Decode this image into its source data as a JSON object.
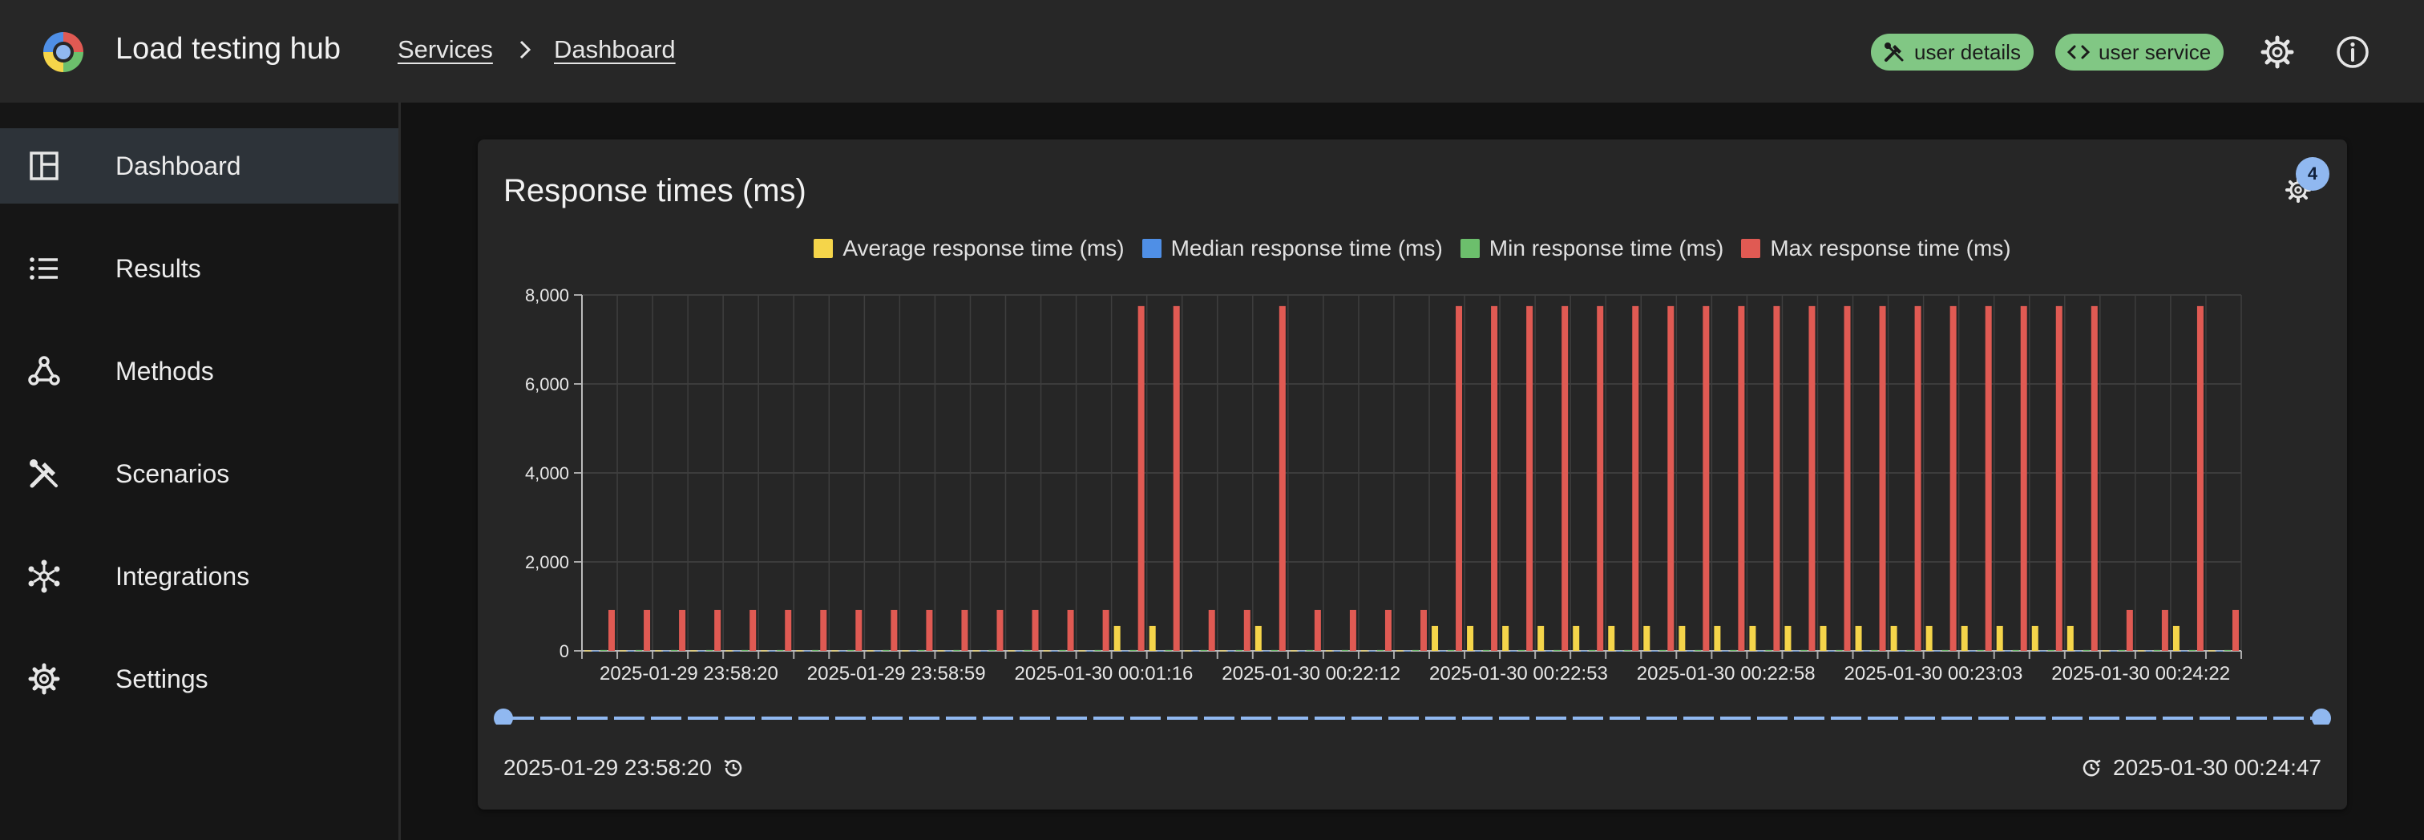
{
  "app": {
    "title": "Load testing hub",
    "breadcrumbs": [
      "Services",
      "Dashboard"
    ],
    "chips": [
      {
        "label": "user details",
        "icon": "tools-icon"
      },
      {
        "label": "user service",
        "icon": "code-icon"
      }
    ]
  },
  "sidebar": {
    "items": [
      {
        "label": "Dashboard",
        "icon": "dashboard-icon",
        "active": true
      },
      {
        "label": "Results",
        "icon": "list-icon"
      },
      {
        "label": "Methods",
        "icon": "webhook-icon"
      },
      {
        "label": "Scenarios",
        "icon": "tools-icon"
      },
      {
        "label": "Integrations",
        "icon": "hub-icon"
      },
      {
        "label": "Settings",
        "icon": "gear-icon"
      }
    ]
  },
  "card": {
    "title": "Response times (ms)",
    "badge_count": "4",
    "range_start": "2025-01-29 23:58:20",
    "range_end": "2025-01-30 00:24:47"
  },
  "colors": {
    "accent": "#90b8f0",
    "chip": "#81c784",
    "average": "#f5d54a",
    "median": "#4f8fe6",
    "min": "#6cbf6c",
    "max": "#e05a53"
  },
  "chart_data": {
    "type": "bar",
    "title": "Response times (ms)",
    "ylim": [
      0,
      8000
    ],
    "yticks": [
      "0",
      "2,000",
      "4,000",
      "6,000",
      "8,000"
    ],
    "xtick_labels": [
      "2025-01-29 23:58:20",
      "2025-01-29 23:58:59",
      "2025-01-30 00:01:16",
      "2025-01-30 00:22:12",
      "2025-01-30 00:22:53",
      "2025-01-30 00:22:58",
      "2025-01-30 00:23:03",
      "2025-01-30 00:24:22"
    ],
    "grid": true,
    "legend_position": "top",
    "series": [
      {
        "name": "Average response time (ms)",
        "values": [
          10,
          10,
          10,
          10,
          10,
          10,
          10,
          10,
          10,
          10,
          10,
          10,
          10,
          10,
          10,
          560,
          560,
          10,
          10,
          560,
          10,
          10,
          10,
          10,
          560,
          560,
          560,
          560,
          560,
          560,
          560,
          560,
          560,
          560,
          560,
          560,
          560,
          560,
          560,
          560,
          560,
          560,
          560,
          10,
          10,
          560,
          10
        ]
      },
      {
        "name": "Median response time (ms)",
        "values": [
          5,
          5,
          5,
          5,
          5,
          5,
          5,
          5,
          5,
          5,
          5,
          5,
          5,
          5,
          5,
          5,
          5,
          5,
          5,
          5,
          5,
          5,
          5,
          5,
          5,
          5,
          5,
          5,
          5,
          5,
          5,
          5,
          5,
          5,
          5,
          5,
          5,
          5,
          5,
          5,
          5,
          5,
          5,
          5,
          5,
          5,
          5
        ]
      },
      {
        "name": "Min response time (ms)",
        "values": [
          20,
          20,
          20,
          20,
          20,
          20,
          20,
          20,
          20,
          20,
          20,
          20,
          20,
          20,
          20,
          20,
          20,
          20,
          20,
          20,
          20,
          20,
          20,
          20,
          20,
          20,
          20,
          20,
          20,
          20,
          20,
          20,
          20,
          20,
          20,
          20,
          20,
          20,
          20,
          20,
          20,
          20,
          20,
          20,
          20,
          20,
          20
        ]
      },
      {
        "name": "Max response time (ms)",
        "values": [
          920,
          920,
          920,
          920,
          920,
          920,
          920,
          920,
          920,
          920,
          920,
          920,
          920,
          920,
          920,
          7750,
          7750,
          920,
          920,
          7750,
          920,
          920,
          920,
          920,
          7750,
          7750,
          7750,
          7750,
          7750,
          7750,
          7750,
          7750,
          7750,
          7750,
          7750,
          7750,
          7750,
          7750,
          7750,
          7750,
          7750,
          7750,
          7750,
          920,
          920,
          7750,
          920
        ]
      }
    ]
  }
}
